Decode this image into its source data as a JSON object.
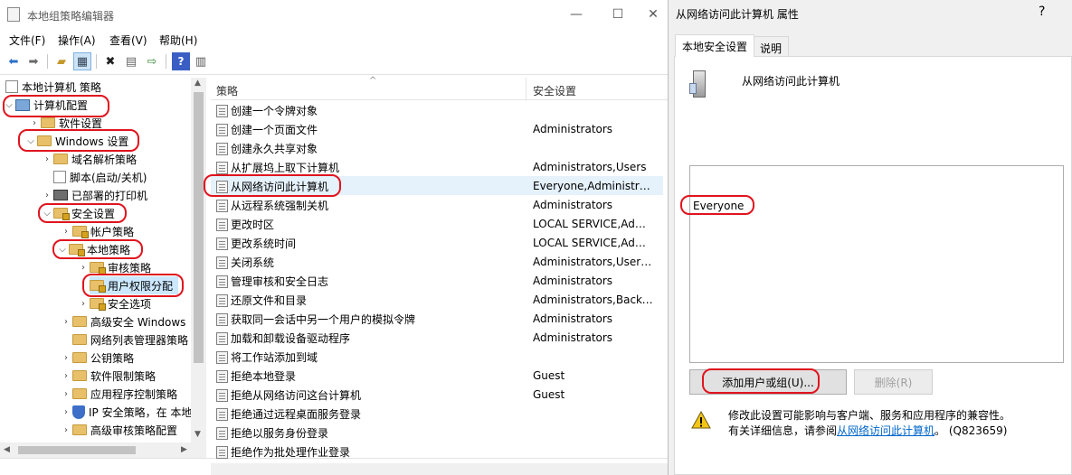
{
  "main_window": {
    "title": "本地组策略编辑器",
    "menu": [
      "文件(F)",
      "操作(A)",
      "查看(V)",
      "帮助(H)"
    ],
    "controls": {
      "minimize": "—",
      "maximize": "☐",
      "close": "✕"
    }
  },
  "toolbar_icons": [
    "back-arrow-icon",
    "forward-arrow-icon",
    "up-folder-icon",
    "show-hide-tree-icon",
    "delete-icon",
    "properties-icon",
    "export-icon",
    "help-icon",
    "action-pane-icon"
  ],
  "tree": {
    "root": "本地计算机 策略",
    "items": [
      "计算机配置",
      "软件设置",
      "Windows 设置",
      "域名解析策略",
      "脚本(启动/关机)",
      "已部署的打印机",
      "安全设置",
      "帐户策略",
      "本地策略",
      "审核策略",
      "用户权限分配",
      "安全选项",
      "高级安全 Windows",
      "网络列表管理器策略",
      "公钥策略",
      "软件限制策略",
      "应用程序控制策略",
      "IP 安全策略，在 本地",
      "高级审核策略配置"
    ]
  },
  "list": {
    "columns": {
      "policy": "策略",
      "setting": "安全设置"
    },
    "rows": [
      {
        "policy": "创建一个令牌对象",
        "setting": ""
      },
      {
        "policy": "创建一个页面文件",
        "setting": "Administrators"
      },
      {
        "policy": "创建永久共享对象",
        "setting": ""
      },
      {
        "policy": "从扩展坞上取下计算机",
        "setting": "Administrators,Users"
      },
      {
        "policy": "从网络访问此计算机",
        "setting": "Everyone,Administrat..."
      },
      {
        "policy": "从远程系统强制关机",
        "setting": "Administrators"
      },
      {
        "policy": "更改时区",
        "setting": "LOCAL SERVICE,Admi..."
      },
      {
        "policy": "更改系统时间",
        "setting": "LOCAL SERVICE,Admi..."
      },
      {
        "policy": "关闭系统",
        "setting": "Administrators,Users,..."
      },
      {
        "policy": "管理审核和安全日志",
        "setting": "Administrators"
      },
      {
        "policy": "还原文件和目录",
        "setting": "Administrators,Backu..."
      },
      {
        "policy": "获取同一会话中另一个用户的模拟令牌",
        "setting": "Administrators"
      },
      {
        "policy": "加载和卸载设备驱动程序",
        "setting": "Administrators"
      },
      {
        "policy": "将工作站添加到域",
        "setting": ""
      },
      {
        "policy": "拒绝本地登录",
        "setting": "Guest"
      },
      {
        "policy": "拒绝从网络访问这台计算机",
        "setting": "Guest"
      },
      {
        "policy": "拒绝通过远程桌面服务登录",
        "setting": ""
      },
      {
        "policy": "拒绝以服务身份登录",
        "setting": ""
      },
      {
        "policy": "拒绝作为批处理作业登录",
        "setting": ""
      }
    ]
  },
  "dialog": {
    "title": "从网络访问此计算机 属性",
    "help": "?",
    "tabs": [
      "本地安全设置",
      "说明"
    ],
    "policy_name": "从网络访问此计算机",
    "members": [
      "Everyone"
    ],
    "add_button": "添加用户或组(U)...",
    "remove_button": "删除(R)",
    "warning_line1": "修改此设置可能影响与客户端、服务和应用程序的兼容性。",
    "warning_line2_prefix": "有关详细信息，请参阅",
    "warning_link": "从网络访问此计算机",
    "warning_line2_suffix": "。 (Q823659)"
  },
  "colors": {
    "annotation": "#e0141e",
    "link": "#0066cc",
    "dialog_bg": "#f0f0f0"
  }
}
